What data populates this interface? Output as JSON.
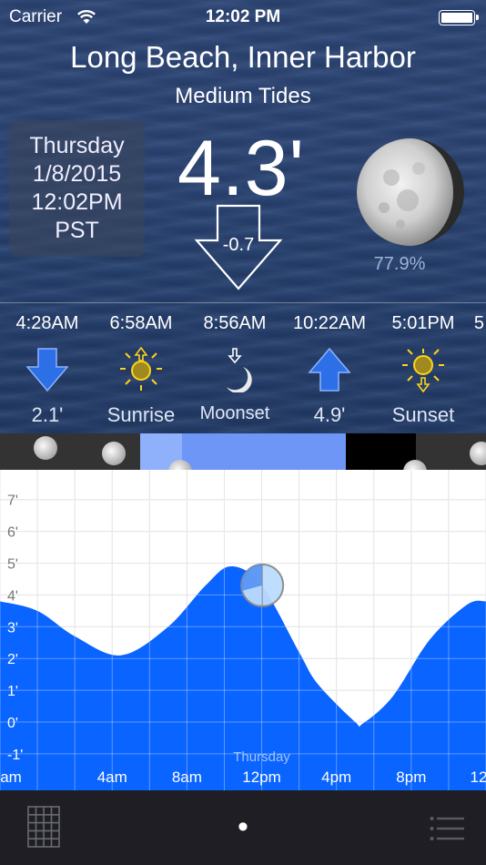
{
  "status_bar": {
    "carrier": "Carrier",
    "time": "12:02 PM"
  },
  "header": {
    "station": "Long Beach, Inner Harbor",
    "tide_type": "Medium Tides"
  },
  "current": {
    "day": "Thursday",
    "date": "1/8/2015",
    "time": "12:02PM",
    "timezone": "PST",
    "height": "4.3'",
    "change": "-0.7",
    "moon_illumination": "77.9%"
  },
  "events": [
    {
      "time": "4:28AM",
      "label": "2.1'",
      "icon": "low-tide-arrow-icon"
    },
    {
      "time": "6:58AM",
      "label": "Sunrise",
      "icon": "sunrise-icon"
    },
    {
      "time": "8:56AM",
      "label": "Moonset",
      "icon": "moonset-icon"
    },
    {
      "time": "10:22AM",
      "label": "4.9'",
      "icon": "high-tide-arrow-icon"
    },
    {
      "time": "5:01PM",
      "label": "Sunset",
      "icon": "sunset-icon"
    },
    {
      "time": "5",
      "label": "",
      "icon": ""
    }
  ],
  "chart_data": {
    "type": "area",
    "xlabel": "",
    "ylabel": "",
    "x_tick_labels": [
      "am",
      "4am",
      "8am",
      "12pm",
      "4pm",
      "8pm",
      "12"
    ],
    "y_tick_labels": [
      "-1'",
      "0'",
      "1'",
      "2'",
      "3'",
      "4'",
      "5'",
      "6'",
      "7'"
    ],
    "day_label": "Thursday",
    "ylim": [
      -1,
      7.5
    ],
    "x_hours": [
      -2,
      0,
      2,
      4.47,
      7,
      9,
      10.37,
      12,
      14,
      15,
      17,
      17.4,
      19,
      21,
      23,
      24
    ],
    "y_feet": [
      3.8,
      3.5,
      2.7,
      2.1,
      3.0,
      4.3,
      4.9,
      4.3,
      2.2,
      1.2,
      0.0,
      -0.05,
      0.8,
      2.6,
      3.7,
      3.8
    ],
    "current_marker": {
      "hour": 12.03,
      "feet": 4.3
    },
    "colors": {
      "fill": "#0a64ff",
      "grid": "#d8d8d8",
      "marker": "#bcdcff"
    }
  },
  "toolbar": {
    "page_indicator": "•"
  }
}
